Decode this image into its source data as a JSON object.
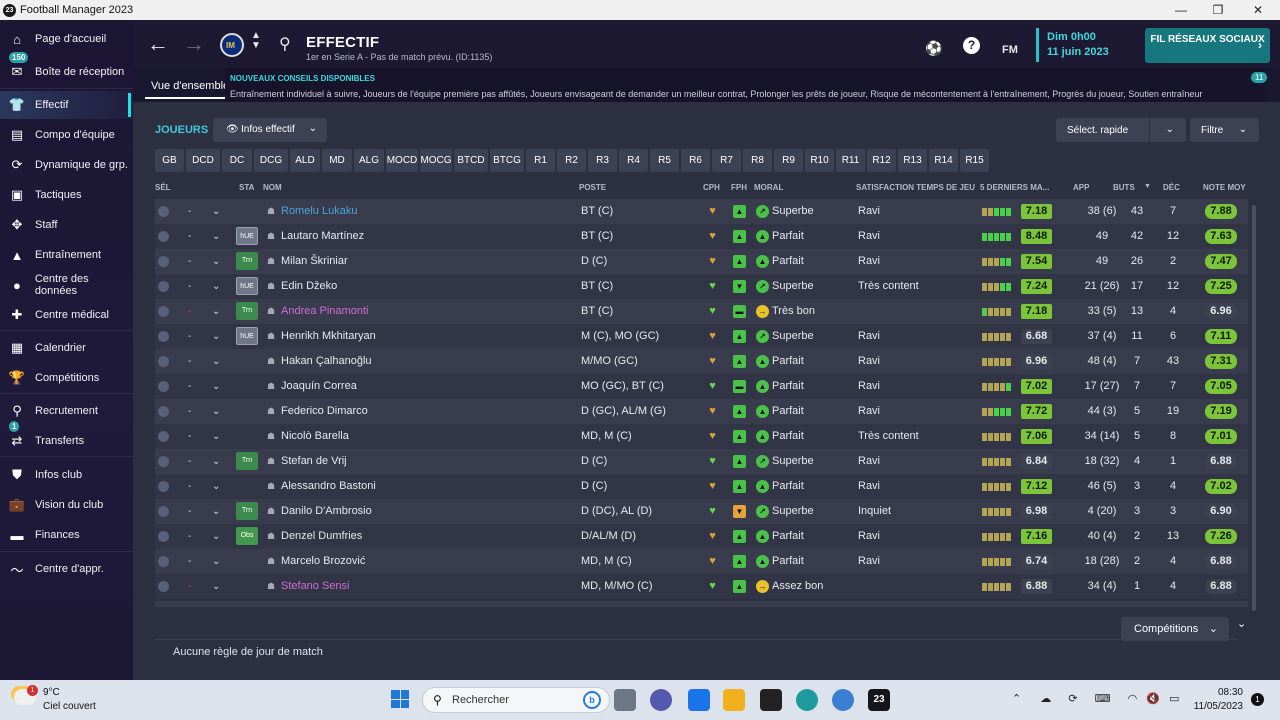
{
  "window": {
    "title": "Football Manager 2023",
    "app_icon": "23"
  },
  "sidebar": {
    "items": [
      {
        "label": "Page d'accueil",
        "icon": "home-icon"
      },
      {
        "label": "Boîte de réception",
        "icon": "inbox-icon",
        "badge": "150"
      },
      {
        "label": "Effectif",
        "icon": "shirt-icon",
        "active": true
      },
      {
        "label": "Compo d'équipe",
        "icon": "clipboard-icon"
      },
      {
        "label": "Dynamique de grp.",
        "icon": "dynamics-icon"
      },
      {
        "label": "Tactiques",
        "icon": "tactics-icon"
      },
      {
        "label": "Staff",
        "icon": "staff-icon"
      },
      {
        "label": "Entraînement",
        "icon": "training-icon"
      },
      {
        "label": "Centre des données",
        "icon": "data-hub-icon"
      },
      {
        "label": "Centre médical",
        "icon": "medical-icon"
      },
      {
        "label": "Calendrier",
        "icon": "calendar-icon"
      },
      {
        "label": "Compétitions",
        "icon": "trophy-icon"
      },
      {
        "label": "Recrutement",
        "icon": "scouting-icon"
      },
      {
        "label": "Transferts",
        "icon": "transfers-icon",
        "badge": "1"
      },
      {
        "label": "Infos club",
        "icon": "club-shield-icon"
      },
      {
        "label": "Vision du club",
        "icon": "briefcase-icon"
      },
      {
        "label": "Finances",
        "icon": "finances-icon"
      },
      {
        "label": "Centre d'appr.",
        "icon": "learning-icon"
      }
    ]
  },
  "header": {
    "title": "EFFECTIF",
    "subtitle": "1er en Serie A - Pas de match prévu. (ID:1135)",
    "fm_label": "FM",
    "date_line1": "Dim 0h00",
    "date_line2": "11 juin 2023",
    "social_button": "FIL RÉSEAUX SOCIAUX"
  },
  "notifications": {
    "tab": "Vue d'ensemble",
    "title": "NOUVEAUX CONSEILS DISPONIBLES",
    "text": "Entraînement individuel à suivre, Joueurs de l'équipe première pas affûtés, Joueurs envisageant de demander un meilleur contrat, Prolonger les prêts de joueur, Risque de mécontentement à l'entraînement, Progrès du joueur, Soutien entraîneur",
    "count": "11"
  },
  "toolbar": {
    "section_title": "JOUEURS",
    "view_dropdown": "Infos effectif",
    "quick_select": "Sélect. rapide",
    "filter": "Filtre"
  },
  "position_filters": [
    "GB",
    "DCD",
    "DC",
    "DCG",
    "ALD",
    "MD",
    "ALG",
    "MOCD",
    "MOCG",
    "BTCD",
    "BTCG",
    "R1",
    "R2",
    "R3",
    "R4",
    "R5",
    "R6",
    "R7",
    "R8",
    "R9",
    "R10",
    "R11",
    "R12",
    "R13",
    "R14",
    "R15"
  ],
  "table": {
    "headers": {
      "sel": "SÉL",
      "sta": "STA",
      "nom": "NOM",
      "poste": "POSTE",
      "cph": "CPH",
      "fph": "FPH",
      "moral": "MORAL",
      "satisfaction": "SATISFACTION TEMPS DE JEU",
      "last5": "5 DERNIERS MA...",
      "app": "APP",
      "buts": "BUTS",
      "sort_indicator": "▼",
      "dec": "DÉC",
      "note": "NOTE MOY"
    },
    "rows": [
      {
        "dash": "-",
        "sta": "",
        "name": "Romelu Lukaku",
        "name_color": "link",
        "poste": "BT (C)",
        "cph": "gold",
        "fph": "up",
        "moral_icon": "up-right",
        "moral": "Superbe",
        "satis": "Ravi",
        "last5": "yyggg",
        "rating": "7.18",
        "rating_style": "green",
        "app": "38 (6)",
        "buts": "43",
        "dec": "7",
        "note": "7.88",
        "note_style": "green"
      },
      {
        "dash": "-",
        "sta": "hUE",
        "name": "Lautaro Martínez",
        "name_color": "",
        "poste": "BT (C)",
        "cph": "gold",
        "fph": "up",
        "moral_icon": "up",
        "moral": "Parfait",
        "satis": "Ravi",
        "last5": "ggggg",
        "rating": "8.48",
        "rating_style": "green",
        "app": "49",
        "buts": "42",
        "dec": "12",
        "note": "7.63",
        "note_style": "green"
      },
      {
        "dash": "-",
        "sta": "Trn",
        "name": "Milan Škriniar",
        "name_color": "",
        "poste": "D (C)",
        "cph": "gold",
        "fph": "up",
        "moral_icon": "up",
        "moral": "Parfait",
        "satis": "Ravi",
        "last5": "yyygg",
        "rating": "7.54",
        "rating_style": "green",
        "app": "49",
        "buts": "26",
        "dec": "2",
        "note": "7.47",
        "note_style": "green"
      },
      {
        "dash": "-",
        "sta": "hUE",
        "name": "Edin Džeko",
        "name_color": "",
        "poste": "BT (C)",
        "cph": "green",
        "fph": "down",
        "moral_icon": "up-right",
        "moral": "Superbe",
        "satis": "Très content",
        "last5": "yyygg",
        "rating": "7.24",
        "rating_style": "green",
        "app": "21 (26)",
        "buts": "17",
        "dec": "12",
        "note": "7.25",
        "note_style": "green"
      },
      {
        "dash": "-",
        "sta": "Trn",
        "name": "Andrea Pinamonti",
        "name_color": "purple",
        "poste": "BT (C)",
        "cph": "green",
        "fph": "flat",
        "moral_icon": "right",
        "moral": "Très bon",
        "satis": "",
        "last5": "gyyyy",
        "rating": "7.18",
        "rating_style": "green",
        "app": "33 (5)",
        "buts": "13",
        "dec": "4",
        "note": "6.96",
        "note_style": "grey"
      },
      {
        "dash": "-",
        "sta": "hUE",
        "name": "Henrikh Mkhitaryan",
        "name_color": "",
        "poste": "M (C), MO (GC)",
        "cph": "gold",
        "fph": "up",
        "moral_icon": "up-right",
        "moral": "Superbe",
        "satis": "Ravi",
        "last5": "yyyyy",
        "rating": "6.68",
        "rating_style": "grey",
        "app": "37 (4)",
        "buts": "11",
        "dec": "6",
        "note": "7.11",
        "note_style": "green"
      },
      {
        "dash": "-",
        "sta": "",
        "name": "Hakan Çalhanoğlu",
        "name_color": "",
        "poste": "M/MO (GC)",
        "cph": "gold",
        "fph": "up",
        "moral_icon": "up",
        "moral": "Parfait",
        "satis": "Ravi",
        "last5": "yyyyy",
        "rating": "6.96",
        "rating_style": "grey",
        "app": "48 (4)",
        "buts": "7",
        "dec": "43",
        "note": "7.31",
        "note_style": "green"
      },
      {
        "dash": "-",
        "sta": "",
        "name": "Joaquín Correa",
        "name_color": "",
        "poste": "MO (GC), BT (C)",
        "cph": "green",
        "fph": "flat",
        "moral_icon": "up",
        "moral": "Parfait",
        "satis": "Ravi",
        "last5": "yyyyg",
        "rating": "7.02",
        "rating_style": "green",
        "app": "17 (27)",
        "buts": "7",
        "dec": "7",
        "note": "7.05",
        "note_style": "green"
      },
      {
        "dash": "-",
        "sta": "",
        "name": "Federico Dimarco",
        "name_color": "",
        "poste": "D (GC), AL/M (G)",
        "cph": "gold",
        "fph": "up",
        "moral_icon": "up",
        "moral": "Parfait",
        "satis": "Ravi",
        "last5": "yyggg",
        "rating": "7.72",
        "rating_style": "green",
        "app": "44 (3)",
        "buts": "5",
        "dec": "19",
        "note": "7.19",
        "note_style": "green"
      },
      {
        "dash": "-",
        "sta": "",
        "name": "Nicolò Barella",
        "name_color": "",
        "poste": "MD, M (C)",
        "cph": "gold",
        "fph": "up",
        "moral_icon": "up",
        "moral": "Parfait",
        "satis": "Très content",
        "last5": "yyyyy",
        "rating": "7.06",
        "rating_style": "green",
        "app": "34 (14)",
        "buts": "5",
        "dec": "8",
        "note": "7.01",
        "note_style": "green"
      },
      {
        "dash": "-",
        "sta": "Trn",
        "name": "Stefan de Vrij",
        "name_color": "",
        "poste": "D (C)",
        "cph": "green",
        "fph": "up",
        "moral_icon": "up-right",
        "moral": "Superbe",
        "satis": "Ravi",
        "last5": "yyyyy",
        "rating": "6.84",
        "rating_style": "grey",
        "app": "18 (32)",
        "buts": "4",
        "dec": "1",
        "note": "6.88",
        "note_style": "grey"
      },
      {
        "dash": "-",
        "sta": "",
        "name": "Alessandro Bastoni",
        "name_color": "",
        "poste": "D (C)",
        "cph": "gold",
        "fph": "up",
        "moral_icon": "up",
        "moral": "Parfait",
        "satis": "Ravi",
        "last5": "yyyyy",
        "rating": "7.12",
        "rating_style": "green",
        "app": "46 (5)",
        "buts": "3",
        "dec": "4",
        "note": "7.02",
        "note_style": "green"
      },
      {
        "dash": "-",
        "sta": "Trn",
        "name": "Danilo D'Ambrosio",
        "name_color": "",
        "poste": "D (DC), AL (D)",
        "cph": "green",
        "fph": "warn",
        "moral_icon": "up-right",
        "moral": "Superbe",
        "satis": "Inquiet",
        "last5": "yyyyy",
        "rating": "6.98",
        "rating_style": "grey",
        "app": "4 (20)",
        "buts": "3",
        "dec": "3",
        "note": "6.90",
        "note_style": "grey"
      },
      {
        "dash": "-",
        "sta": "Obs",
        "name": "Denzel Dumfries",
        "name_color": "",
        "poste": "D/AL/M (D)",
        "cph": "gold",
        "fph": "up",
        "moral_icon": "up",
        "moral": "Parfait",
        "satis": "Ravi",
        "last5": "yyyyy",
        "rating": "7.16",
        "rating_style": "green",
        "app": "40 (4)",
        "buts": "2",
        "dec": "13",
        "note": "7.26",
        "note_style": "green"
      },
      {
        "dash": "-",
        "sta": "",
        "name": "Marcelo Brozović",
        "name_color": "",
        "poste": "MD, M (C)",
        "cph": "gold",
        "fph": "up",
        "moral_icon": "up",
        "moral": "Parfait",
        "satis": "Ravi",
        "last5": "yyyyy",
        "rating": "6.74",
        "rating_style": "grey",
        "app": "18 (28)",
        "buts": "2",
        "dec": "4",
        "note": "6.88",
        "note_style": "grey"
      },
      {
        "dash": "-",
        "sta": "",
        "name": "Stefano Sensi",
        "name_color": "purple",
        "poste": "MD, M/MO (C)",
        "cph": "green",
        "fph": "up",
        "moral_icon": "right",
        "moral": "Assez bon",
        "satis": "",
        "last5": "yyyyy",
        "rating": "6.88",
        "rating_style": "grey",
        "app": "34 (4)",
        "buts": "1",
        "dec": "4",
        "note": "6.88",
        "note_style": "grey"
      }
    ]
  },
  "footer": {
    "match_rules": "Aucune règle de jour de match",
    "competitions_button": "Compétitions"
  },
  "taskbar": {
    "weather_temp": "9°C",
    "weather_desc": "Ciel couvert",
    "weather_badge": "1",
    "search_placeholder": "Rechercher",
    "time": "08:30",
    "date": "11/05/2023",
    "notif_count": "1"
  },
  "colors": {
    "accent": "#40d7de",
    "rating_green": "#7cc43a",
    "rating_grey": "#3d4150",
    "link": "#4fa3de",
    "purple_name": "#cf6ed2"
  }
}
